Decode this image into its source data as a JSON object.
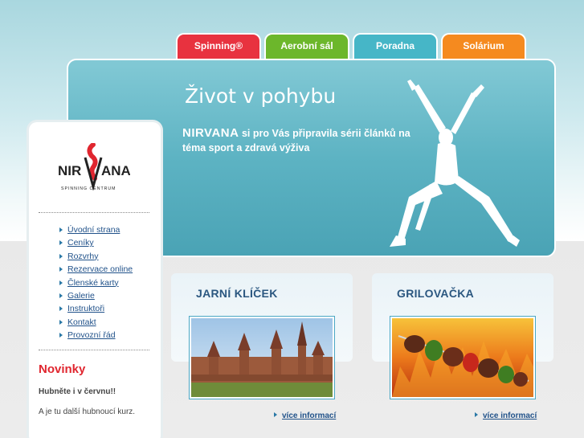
{
  "tabs": [
    {
      "label": "Spinning®"
    },
    {
      "label": "Aerobní sál"
    },
    {
      "label": "Poradna"
    },
    {
      "label": "Solárium"
    }
  ],
  "hero": {
    "title": "Život v pohybu",
    "brand": "NIRVANA",
    "text": "si pro Vás připravila sérii článků na téma sport a zdravá výživa"
  },
  "logo": {
    "name": "NIRVANA",
    "tagline": "SPINNING CENTRUM"
  },
  "menu": [
    {
      "label": "Úvodní strana"
    },
    {
      "label": "Ceníky"
    },
    {
      "label": "Rozvrhy"
    },
    {
      "label": "Rezervace online"
    },
    {
      "label": "Členské karty"
    },
    {
      "label": "Galerie"
    },
    {
      "label": "Instruktoři"
    },
    {
      "label": "Kontakt"
    },
    {
      "label": "Provozní řád"
    }
  ],
  "news": {
    "title": "Novinky",
    "subtitle": "Hubněte i v červnu!!",
    "text": "A je tu další hubnoucí kurz."
  },
  "boxes": [
    {
      "title": "JARNÍ KLÍČEK",
      "more": "více informací"
    },
    {
      "title": "GRILOVAČKA",
      "more": "více informací"
    }
  ],
  "colors": {
    "spinning": "#e8323f",
    "aerobic": "#6cb72b",
    "poradna": "#46b6c7",
    "solarium": "#f58a1f",
    "hero": "#5db3c3"
  }
}
